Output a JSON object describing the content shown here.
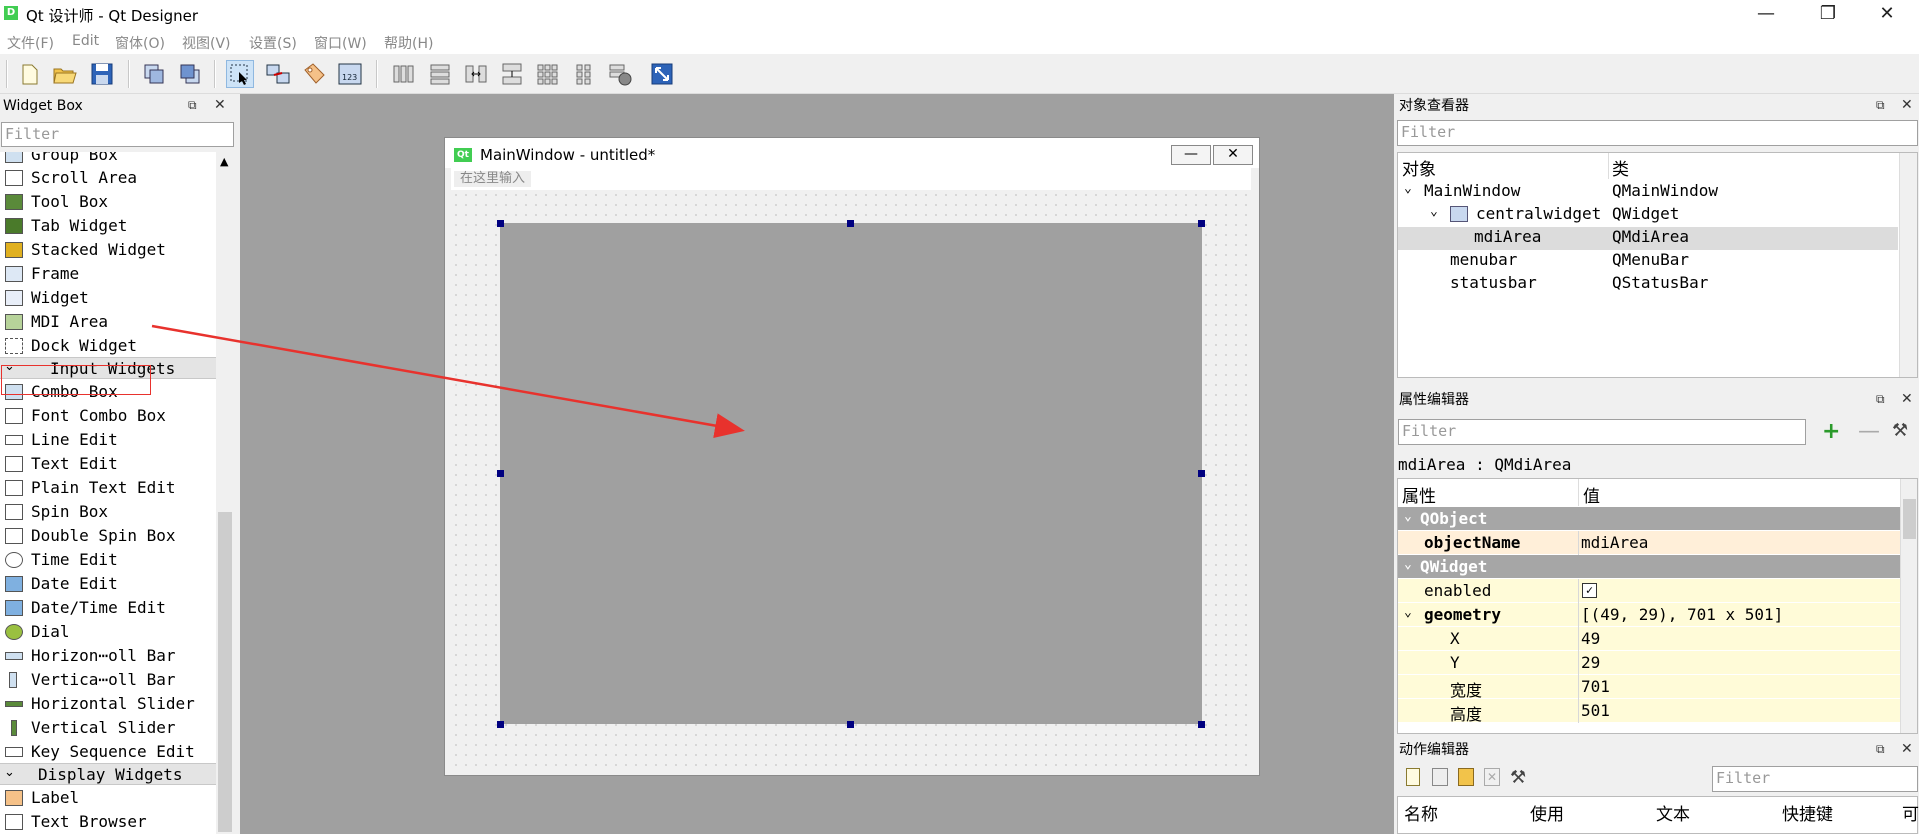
{
  "app": {
    "title": "Qt 设计师 - Qt Designer",
    "icon_letter": "D",
    "window_controls": {
      "minimize": "—",
      "restore": "❐",
      "close": "✕"
    }
  },
  "menubar": {
    "items": [
      "文件(F)",
      "Edit",
      "窗体(O)",
      "视图(V)",
      "设置(S)",
      "窗口(W)",
      "帮助(H)"
    ]
  },
  "widget_box": {
    "title": "Widget Box",
    "filter_placeholder": "Filter",
    "items": [
      {
        "label": "Group Box",
        "icon": "group-box-icon"
      },
      {
        "label": "Scroll Area",
        "icon": "scroll-area-icon"
      },
      {
        "label": "Tool Box",
        "icon": "tool-box-icon"
      },
      {
        "label": "Tab Widget",
        "icon": "tab-widget-icon"
      },
      {
        "label": "Stacked Widget",
        "icon": "stacked-widget-icon"
      },
      {
        "label": "Frame",
        "icon": "frame-icon"
      },
      {
        "label": "Widget",
        "icon": "widget-icon"
      },
      {
        "label": "MDI Area",
        "icon": "mdi-area-icon"
      },
      {
        "label": "Dock Widget",
        "icon": "dock-widget-icon"
      }
    ],
    "category_input": "Input Widgets",
    "input_items": [
      {
        "label": "Combo Box",
        "icon": "combo-box-icon"
      },
      {
        "label": "Font Combo Box",
        "icon": "font-combo-box-icon"
      },
      {
        "label": "Line Edit",
        "icon": "line-edit-icon"
      },
      {
        "label": "Text Edit",
        "icon": "text-edit-icon"
      },
      {
        "label": "Plain Text Edit",
        "icon": "plain-text-edit-icon"
      },
      {
        "label": "Spin Box",
        "icon": "spin-box-icon"
      },
      {
        "label": "Double Spin Box",
        "icon": "double-spin-box-icon"
      },
      {
        "label": "Time Edit",
        "icon": "time-edit-icon"
      },
      {
        "label": "Date Edit",
        "icon": "date-edit-icon"
      },
      {
        "label": "Date/Time Edit",
        "icon": "date-time-edit-icon"
      },
      {
        "label": "Dial",
        "icon": "dial-icon"
      },
      {
        "label": "Horizon⋯oll Bar",
        "icon": "horizontal-scroll-bar-icon"
      },
      {
        "label": "Vertica⋯oll Bar",
        "icon": "vertical-scroll-bar-icon"
      },
      {
        "label": "Horizontal Slider",
        "icon": "horizontal-slider-icon"
      },
      {
        "label": "Vertical Slider",
        "icon": "vertical-slider-icon"
      },
      {
        "label": "Key Sequence Edit",
        "icon": "key-sequence-edit-icon"
      }
    ],
    "category_display": "Display Widgets",
    "display_items": [
      {
        "label": "Label",
        "icon": "label-icon"
      },
      {
        "label": "Text Browser",
        "icon": "text-browser-icon"
      }
    ]
  },
  "form_window": {
    "title": "MainWindow - untitled*",
    "qt_badge": "Qt",
    "menu_placeholder": "在这里输入",
    "minimize": "—",
    "close": "✕"
  },
  "object_inspector": {
    "title": "对象查看器",
    "filter_placeholder": "Filter",
    "col_object": "对象",
    "col_class": "类",
    "rows": [
      {
        "name": "MainWindow",
        "cls": "QMainWindow"
      },
      {
        "name": "centralwidget",
        "cls": "QWidget"
      },
      {
        "name": "mdiArea",
        "cls": "QMdiArea"
      },
      {
        "name": "menubar",
        "cls": "QMenuBar"
      },
      {
        "name": "statusbar",
        "cls": "QStatusBar"
      }
    ]
  },
  "property_editor": {
    "title": "属性编辑器",
    "filter_placeholder": "Filter",
    "context": "mdiArea : QMdiArea",
    "col_property": "属性",
    "col_value": "值",
    "group_qobject": "QObject",
    "object_name_label": "objectName",
    "object_name_value": "mdiArea",
    "group_qwidget": "QWidget",
    "enabled_label": "enabled",
    "enabled_value": "✓",
    "geometry_label": "geometry",
    "geometry_value": "[(49, 29), 701 x 501]",
    "x_label": "X",
    "x_value": "49",
    "y_label": "Y",
    "y_value": "29",
    "width_label": "宽度",
    "width_value": "701",
    "height_label": "高度",
    "height_value": "501"
  },
  "action_editor": {
    "title": "动作编辑器",
    "filter_placeholder": "Filter",
    "columns": [
      "名称",
      "使用",
      "文本",
      "快捷键",
      "可"
    ]
  },
  "colors": {
    "canvas_gray": "#a0a0a0",
    "group_header": "#a6a6a6",
    "prop_yellow": "#fffbd8",
    "prop_orange": "#ffefd9",
    "arrow_red": "#e8322d",
    "selection": "#cde3f7"
  }
}
